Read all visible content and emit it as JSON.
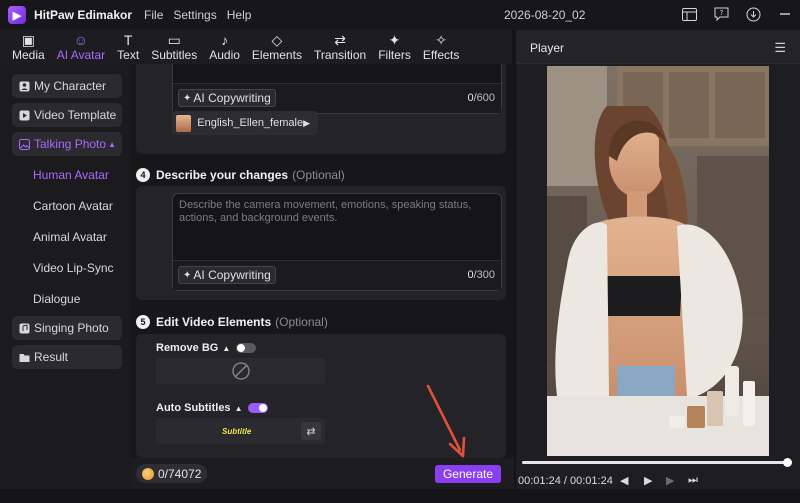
{
  "app": {
    "name": "HitPaw Edimakor",
    "project": "2026-08-20_02"
  },
  "menu": [
    "File",
    "Settings",
    "Help"
  ],
  "tabs": [
    {
      "label": "Media",
      "icon": "image-icon",
      "glyph": "▣"
    },
    {
      "label": "AI Avatar",
      "icon": "avatar-icon",
      "glyph": "☺",
      "active": true
    },
    {
      "label": "Text",
      "icon": "text-icon",
      "glyph": "T"
    },
    {
      "label": "Subtitles",
      "icon": "subtitles-icon",
      "glyph": "▭"
    },
    {
      "label": "Audio",
      "icon": "music-note-icon",
      "glyph": "♪"
    },
    {
      "label": "Elements",
      "icon": "elements-icon",
      "glyph": "◇"
    },
    {
      "label": "Transition",
      "icon": "transition-icon",
      "glyph": "⇄"
    },
    {
      "label": "Filters",
      "icon": "sparkle-icon",
      "glyph": "✦"
    },
    {
      "label": "Effects",
      "icon": "magic-wand-icon",
      "glyph": "✧"
    }
  ],
  "sidebar": {
    "items": [
      {
        "label": "My Character",
        "icon": "user-card-icon"
      },
      {
        "label": "Video Template",
        "icon": "video-template-icon"
      },
      {
        "label": "Talking Photo",
        "icon": "photo-icon",
        "active": true,
        "expanded": true
      },
      {
        "label": "Singing Photo",
        "icon": "singing-photo-icon"
      },
      {
        "label": "Result",
        "icon": "folder-icon"
      }
    ],
    "subitems": [
      {
        "label": "Human Avatar",
        "active": true
      },
      {
        "label": "Cartoon Avatar"
      },
      {
        "label": "Animal Avatar"
      },
      {
        "label": "Video Lip-Sync"
      },
      {
        "label": "Dialogue"
      }
    ]
  },
  "script_box": {
    "ai_label": "AI Copywriting",
    "count": "0",
    "max": "/600",
    "voice": "English_Ellen_female"
  },
  "step4": {
    "number": "4",
    "title": "Describe your changes",
    "optional": "(Optional)",
    "placeholder": "Describe the camera movement, emotions, speaking status, actions, and background events.",
    "ai_label": "AI Copywriting",
    "count": "0",
    "max": "/300"
  },
  "step5": {
    "number": "5",
    "title": "Edit Video Elements",
    "optional": "(Optional)",
    "remove_bg": {
      "label": "Remove BG",
      "enabled": false
    },
    "auto_subtitles": {
      "label": "Auto Subtitles",
      "enabled": true,
      "preview": "Subtitle"
    }
  },
  "footer": {
    "credits": "0/74072",
    "generate": "Generate"
  },
  "player": {
    "title": "Player",
    "current_time": "00:01:24",
    "separator": "/",
    "total_time": "00:01:24",
    "progress": 1.0
  },
  "colors": {
    "accent": "#8a3ff0",
    "accent_text": "#a66bff",
    "annotation_arrow": "#e0523a"
  }
}
